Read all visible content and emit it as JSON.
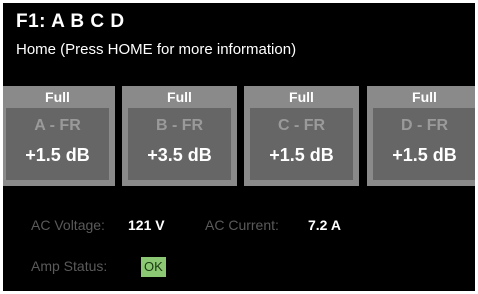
{
  "header": {
    "title": "F1: A B C D",
    "subtitle": "Home (Press HOME for more information)"
  },
  "channels": [
    {
      "mode": "Full",
      "name": "A - FR",
      "gain": "+1.5 dB"
    },
    {
      "mode": "Full",
      "name": "B - FR",
      "gain": "+3.5 dB"
    },
    {
      "mode": "Full",
      "name": "C - FR",
      "gain": "+1.5 dB"
    },
    {
      "mode": "Full",
      "name": "D - FR",
      "gain": "+1.5 dB"
    }
  ],
  "power": {
    "voltage_label": "AC Voltage:",
    "voltage_value": "121 V",
    "current_label": "AC Current:",
    "current_value": "7.2 A"
  },
  "status": {
    "label": "Amp Status:",
    "value": "OK"
  },
  "colors": {
    "background": "#000000",
    "channel_frame": "#8a8a8a",
    "channel_panel": "#666666",
    "status_ok": "#8cc873"
  }
}
